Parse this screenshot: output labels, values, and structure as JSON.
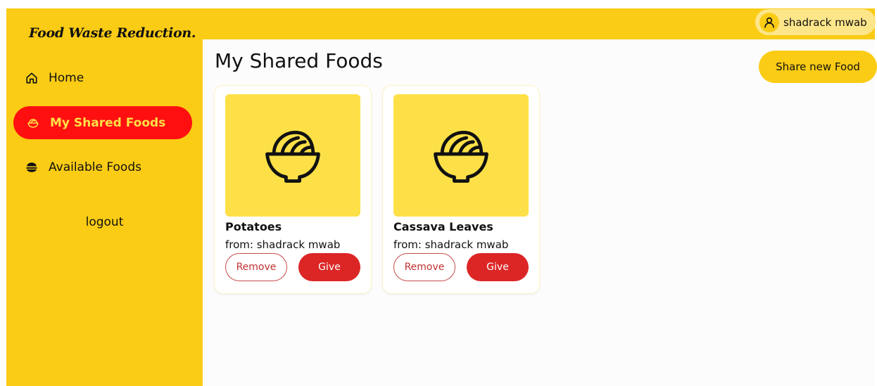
{
  "app": {
    "brand": "Food Waste Reduction."
  },
  "sidebar": {
    "items": [
      {
        "label": "Home",
        "icon": "home-icon"
      },
      {
        "label": "My Shared Foods",
        "icon": "bowl-icon",
        "active": true
      },
      {
        "label": "Available Foods",
        "icon": "burger-icon"
      }
    ],
    "logout": "logout"
  },
  "header": {
    "user_name": "shadrack mwab",
    "user_icon": "user-icon"
  },
  "main": {
    "title": "My Shared Foods",
    "share_button": "Share new Food",
    "cards": [
      {
        "name": "Potatoes",
        "from": "from: shadrack mwab",
        "remove_label": "Remove",
        "give_label": "Give",
        "image_icon": "bowl-icon"
      },
      {
        "name": "Cassava Leaves",
        "from": "from: shadrack mwab",
        "remove_label": "Remove",
        "give_label": "Give",
        "image_icon": "bowl-icon"
      }
    ]
  },
  "colors": {
    "accent": "#facc15",
    "active_nav": "#ff0f0f",
    "active_nav_text": "#fde047",
    "danger": "#dc2626",
    "card_image_bg": "#fde047"
  }
}
